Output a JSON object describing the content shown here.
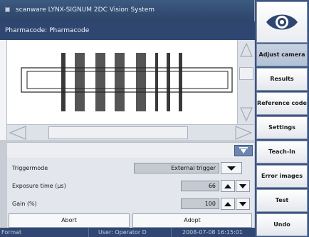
{
  "window": {
    "title": "scanware LYNX-SIGNUM 2DC Vision System",
    "subtitle": "Pharmacode: Pharmacode"
  },
  "icons": {
    "system_menu": "system-menu-icon",
    "logo": "eye-icon",
    "collapse": "arrow-down-icon",
    "scroll_up": "triangle-up-icon",
    "scroll_down": "triangle-down-icon",
    "scroll_left": "triangle-left-icon",
    "scroll_right": "triangle-right-icon"
  },
  "parameters": [
    {
      "label": "Triggermode",
      "value": "External trigger"
    },
    {
      "label": "Exposure time (µs)",
      "value": "66"
    },
    {
      "label": "Gain (%)",
      "value": "100"
    }
  ],
  "actions": {
    "abort": "Abort",
    "adopt": "Adopt"
  },
  "status": {
    "mode": "Format",
    "user": "User: Operator D",
    "datetime": "2008-07-08 16:15:01"
  },
  "menu": [
    {
      "label": "Adjust camera",
      "active": true
    },
    {
      "label": "Results",
      "active": false
    },
    {
      "label": "Reference code",
      "active": false
    },
    {
      "label": "Settings",
      "active": false
    },
    {
      "label": "Teach-In",
      "active": false
    },
    {
      "label": "Error images",
      "active": false
    },
    {
      "label": "Test",
      "active": false
    },
    {
      "label": "Undo",
      "active": false
    }
  ],
  "colors": {
    "titlebar": "#2c4468",
    "active_menu": "#b3c1d6",
    "bar_dark": "#2a2a2a",
    "bar_gray": "#6a6a6a"
  }
}
